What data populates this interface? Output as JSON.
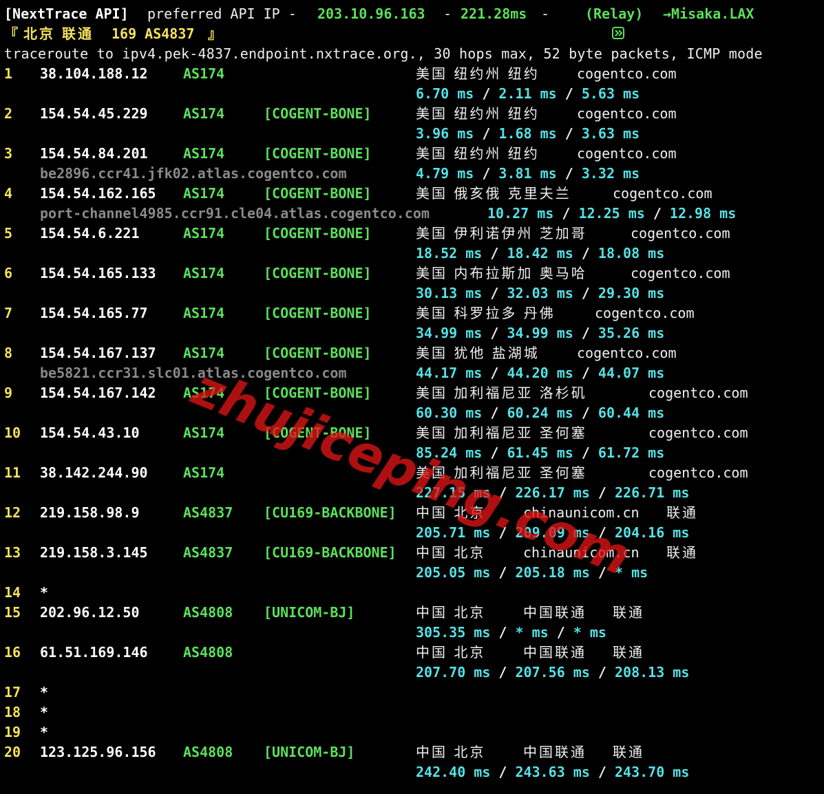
{
  "header": {
    "api_label": "[NextTrace API]",
    "preferred_text": "preferred API IP -",
    "api_ip": "203.10.96.163",
    "sep1": "-",
    "latency": "221.28ms",
    "sep2": "-",
    "relay_icon": "relay-icon",
    "relay_text": "(Relay)",
    "arrow_dest": "→Misaka.LAX",
    "target_open": "『",
    "target_location": "北京 联通",
    "target_asn": "169 AS4837",
    "target_close": "』",
    "traceroute_line": "traceroute to ipv4.pek-4837.endpoint.nxtrace.org., 30 hops max, 52 byte packets, ICMP mode"
  },
  "hops": [
    {
      "num": "1",
      "ip": "38.104.188.12",
      "asn": "AS174",
      "tag": "",
      "geo": "美国 纽约州 纽约",
      "domain": "cogentco.com",
      "isp": "",
      "rdns": "",
      "times": [
        "6.70 ms",
        "2.11 ms",
        "5.63 ms"
      ]
    },
    {
      "num": "2",
      "ip": "154.54.45.229",
      "asn": "AS174",
      "tag": "[COGENT-BONE]",
      "geo": "美国 纽约州 纽约",
      "domain": "cogentco.com",
      "isp": "",
      "rdns": "",
      "times": [
        "3.96 ms",
        "1.68 ms",
        "3.63 ms"
      ]
    },
    {
      "num": "3",
      "ip": "154.54.84.201",
      "asn": "AS174",
      "tag": "[COGENT-BONE]",
      "geo": "美国 纽约州 纽约",
      "domain": "cogentco.com",
      "isp": "",
      "rdns": "be2896.ccr41.jfk02.atlas.cogentco.com",
      "times": [
        "4.79 ms",
        "3.81 ms",
        "3.32 ms"
      ]
    },
    {
      "num": "4",
      "ip": "154.54.162.165",
      "asn": "AS174",
      "tag": "[COGENT-BONE]",
      "geo": "美国 俄亥俄 克里夫兰",
      "domain": "cogentco.com",
      "isp": "",
      "rdns": "port-channel4985.ccr91.cle04.atlas.cogentco.com",
      "times": [
        "10.27 ms",
        "12.25 ms",
        "12.98 ms"
      ]
    },
    {
      "num": "5",
      "ip": "154.54.6.221",
      "asn": "AS174",
      "tag": "[COGENT-BONE]",
      "geo": "美国 伊利诺伊州 芝加哥",
      "domain": "cogentco.com",
      "isp": "",
      "rdns": "",
      "times": [
        "18.52 ms",
        "18.42 ms",
        "18.08 ms"
      ]
    },
    {
      "num": "6",
      "ip": "154.54.165.133",
      "asn": "AS174",
      "tag": "[COGENT-BONE]",
      "geo": "美国 内布拉斯加 奥马哈",
      "domain": "cogentco.com",
      "isp": "",
      "rdns": "",
      "times": [
        "30.13 ms",
        "32.03 ms",
        "29.30 ms"
      ]
    },
    {
      "num": "7",
      "ip": "154.54.165.77",
      "asn": "AS174",
      "tag": "[COGENT-BONE]",
      "geo": "美国 科罗拉多 丹佛",
      "domain": "cogentco.com",
      "isp": "",
      "rdns": "",
      "times": [
        "34.99 ms",
        "34.99 ms",
        "35.26 ms"
      ]
    },
    {
      "num": "8",
      "ip": "154.54.167.137",
      "asn": "AS174",
      "tag": "[COGENT-BONE]",
      "geo": "美国 犹他 盐湖城",
      "domain": "cogentco.com",
      "isp": "",
      "rdns": "be5821.ccr31.slc01.atlas.cogentco.com",
      "times": [
        "44.17 ms",
        "44.20 ms",
        "44.07 ms"
      ]
    },
    {
      "num": "9",
      "ip": "154.54.167.142",
      "asn": "AS174",
      "tag": "[COGENT-BONE]",
      "geo": "美国 加利福尼亚 洛杉矶",
      "domain": "cogentco.com",
      "isp": "",
      "rdns": "",
      "times": [
        "60.30 ms",
        "60.24 ms",
        "60.44 ms"
      ]
    },
    {
      "num": "10",
      "ip": "154.54.43.10",
      "asn": "AS174",
      "tag": "[COGENT-BONE]",
      "geo": "美国 加利福尼亚 圣何塞",
      "domain": "cogentco.com",
      "isp": "",
      "rdns": "",
      "times": [
        "85.24 ms",
        "61.45 ms",
        "61.72 ms"
      ]
    },
    {
      "num": "11",
      "ip": "38.142.244.90",
      "asn": "AS174",
      "tag": "",
      "geo": "美国 加利福尼亚 圣何塞",
      "domain": "cogentco.com",
      "isp": "",
      "rdns": "",
      "times": [
        "227.15 ms",
        "226.17 ms",
        "226.71 ms"
      ]
    },
    {
      "num": "12",
      "ip": "219.158.98.9",
      "asn": "AS4837",
      "tag": "[CU169-BACKBONE]",
      "geo": "中国 北京",
      "domain": "chinaunicom.cn",
      "isp": "联通",
      "rdns": "",
      "times": [
        "205.71 ms",
        "209.09 ms",
        "204.16 ms"
      ]
    },
    {
      "num": "13",
      "ip": "219.158.3.145",
      "asn": "AS4837",
      "tag": "[CU169-BACKBONE]",
      "geo": "中国 北京",
      "domain": "chinaunicom.cn",
      "isp": "联通",
      "rdns": "",
      "times": [
        "205.05 ms",
        "205.18 ms",
        "* ms"
      ]
    },
    {
      "num": "14",
      "ip": "*",
      "asn": "",
      "tag": "",
      "geo": "",
      "domain": "",
      "isp": "",
      "rdns": "",
      "times": []
    },
    {
      "num": "15",
      "ip": "202.96.12.50",
      "asn": "AS4808",
      "tag": "[UNICOM-BJ]",
      "geo": "中国 北京",
      "domain": "中国联通",
      "isp": "联通",
      "rdns": "",
      "times": [
        "305.35 ms",
        "* ms",
        "* ms"
      ]
    },
    {
      "num": "16",
      "ip": "61.51.169.146",
      "asn": "AS4808",
      "tag": "",
      "geo": "中国 北京",
      "domain": "中国联通",
      "isp": "联通",
      "rdns": "",
      "times": [
        "207.70 ms",
        "207.56 ms",
        "208.13 ms"
      ]
    },
    {
      "num": "17",
      "ip": "*",
      "asn": "",
      "tag": "",
      "geo": "",
      "domain": "",
      "isp": "",
      "rdns": "",
      "times": []
    },
    {
      "num": "18",
      "ip": "*",
      "asn": "",
      "tag": "",
      "geo": "",
      "domain": "",
      "isp": "",
      "rdns": "",
      "times": []
    },
    {
      "num": "19",
      "ip": "*",
      "asn": "",
      "tag": "",
      "geo": "",
      "domain": "",
      "isp": "",
      "rdns": "",
      "times": []
    },
    {
      "num": "20",
      "ip": "123.125.96.156",
      "asn": "AS4808",
      "tag": "[UNICOM-BJ]",
      "geo": "中国 北京",
      "domain": "中国联通",
      "isp": "联通",
      "rdns": "",
      "times": [
        "242.40 ms",
        "243.63 ms",
        "243.70 ms"
      ]
    }
  ],
  "time_separator": " / ",
  "watermark": "zhujiceping.com",
  "colors": {
    "background": "#000000",
    "hop_number": "#f3e35a",
    "ip": "#ffffff",
    "asn": "#5be05b",
    "tag": "#5be05b",
    "latency": "#54e2e6",
    "rdns": "#8a8a8a",
    "watermark": "#dc1414"
  }
}
